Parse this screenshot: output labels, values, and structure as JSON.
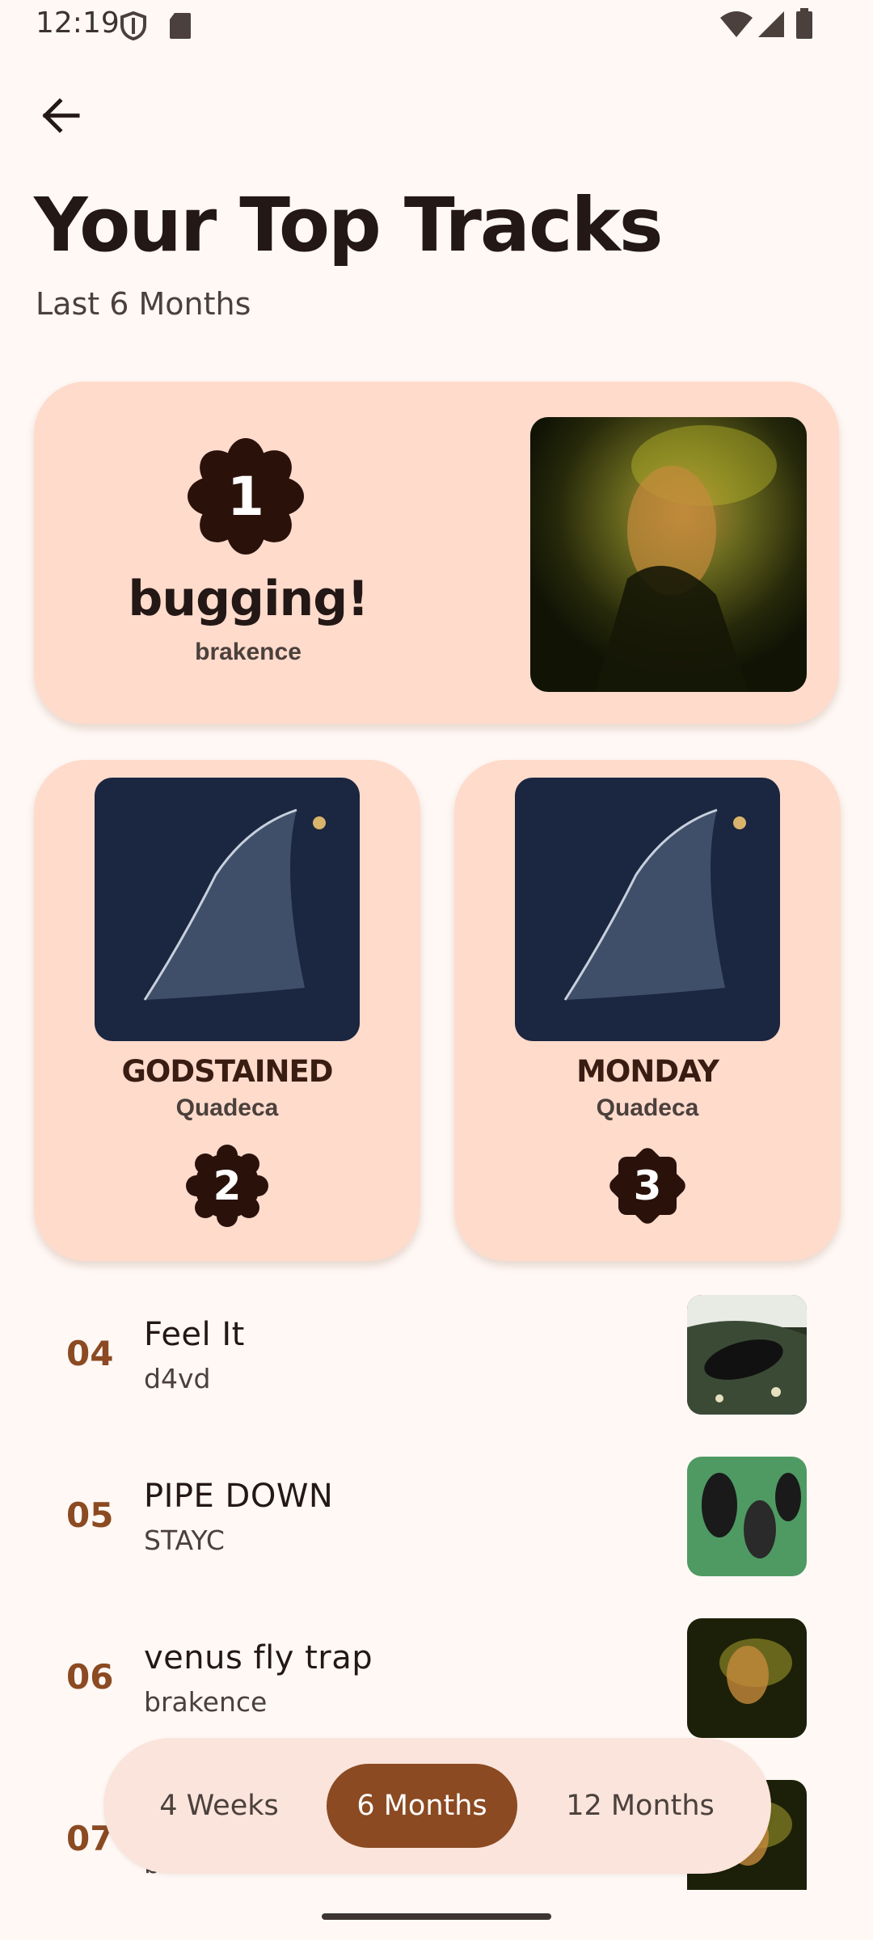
{
  "status": {
    "time": "12:19"
  },
  "header": {
    "title": "Your Top Tracks",
    "subtitle": "Last 6 Months"
  },
  "top_three": [
    {
      "rank": "1",
      "title": "bugging!",
      "artist": "brakence"
    },
    {
      "rank": "2",
      "title": "GODSTAINED",
      "artist": "Quadeca"
    },
    {
      "rank": "3",
      "title": "MONDAY",
      "artist": "Quadeca"
    }
  ],
  "list": [
    {
      "rank": "04",
      "title": "Feel It",
      "artist": "d4vd"
    },
    {
      "rank": "05",
      "title": "PIPE DOWN",
      "artist": "STAYC"
    },
    {
      "rank": "06",
      "title": "venus fly trap",
      "artist": "brakence"
    },
    {
      "rank": "07",
      "title": "",
      "artist": "brakence"
    }
  ],
  "range_selector": {
    "options": [
      "4 Weeks",
      "6 Months",
      "12 Months"
    ],
    "selected": "6 Months"
  },
  "colors": {
    "background": "#fff8f5",
    "card": "#ffdbcc",
    "accent": "#8b4a22",
    "badge": "#2a120b"
  }
}
